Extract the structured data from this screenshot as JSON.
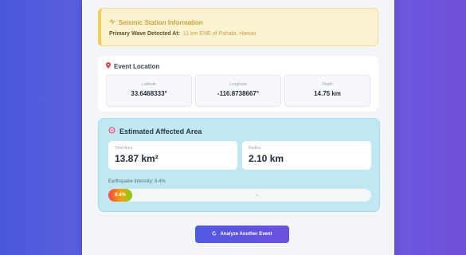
{
  "station": {
    "title": "Seismic Station Information",
    "detected_label": "Primary Wave Detected At:",
    "detected_value": "11 km ENE of Pahala, Hawaii"
  },
  "event_location": {
    "title": "Event Location",
    "latitude_label": "Latitude",
    "latitude_value": "33.6468333°",
    "longitude_label": "Longitude",
    "longitude_value": "-116.8738667°",
    "depth_label": "Depth",
    "depth_value": "14.75 km"
  },
  "affected_area": {
    "title": "Estimated Affected Area",
    "total_area_label": "Total Area",
    "total_area_value": "13.87 km²",
    "radius_label": "Radius",
    "radius_value": "2.10 km",
    "intensity_label": "Earthquake Intensity: 9.4%",
    "intensity_fill_text": "9.4%",
    "intensity_percent": 9.4
  },
  "actions": {
    "analyze_label": "Analyze Another Event"
  },
  "colors": {
    "background": "#5d5fe2",
    "station_accent": "#f4cf52",
    "affected_bg": "#bfe8f2",
    "button": "#5a56df"
  },
  "icons": {
    "station": "seismograph-icon",
    "location": "map-pin-icon",
    "area": "target-icon",
    "analyze": "refresh-icon"
  }
}
